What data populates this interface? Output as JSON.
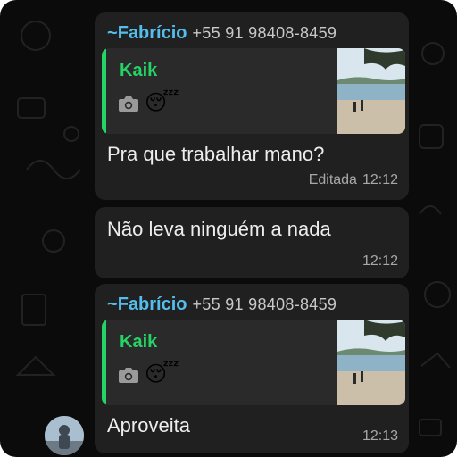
{
  "messages": [
    {
      "sender_prefix": "~",
      "sender_name": "Fabrício",
      "sender_phone": "+55 91 98408-8459",
      "quote_author": "Kaik",
      "quote_emoji": "😴",
      "text": "Pra que trabalhar mano?",
      "edited_label": "Editada",
      "time": "12:12"
    },
    {
      "text": "Não leva ninguém a nada",
      "time": "12:12"
    },
    {
      "sender_prefix": "~",
      "sender_name": "Fabrício",
      "sender_phone": "+55 91 98408-8459",
      "quote_author": "Kaik",
      "quote_emoji": "😴",
      "text": "Aproveita",
      "time": "12:13"
    }
  ],
  "icons": {
    "quote_media": "camera-icon"
  },
  "colors": {
    "background": "#0b0b0b",
    "bubble": "#202020",
    "quote_box": "#2a2a2a",
    "sender_name": "#53bdeb",
    "quote_accent": "#25d366",
    "text": "#ededed",
    "meta": "#a8a8a8"
  }
}
